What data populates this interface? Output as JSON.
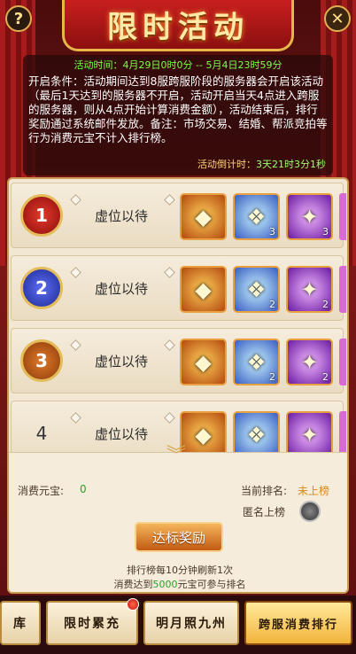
{
  "header": {
    "title": "限时活动",
    "help_icon": "help-icon",
    "close_icon": "close-icon"
  },
  "info": {
    "time_label": "活动时间：",
    "time_value": "4月29日0时0分 -- 5月4日23时59分",
    "description": "开启条件：活动期间达到8服跨服阶段的服务器会开启该活动（最后1天达到的服务器不开启，活动开启当天4点进入跨服的服务器，则从4点开始计算消费金额），活动结束后，排行奖励通过系统邮件发放。备注：市场交易、结婚、帮派竞拍等行为消费元宝不计入排行榜。",
    "countdown_label": "活动倒计时：",
    "countdown_value": "3天21时3分1秒"
  },
  "rankings": [
    {
      "rank": "1",
      "name": "虚位以待",
      "rewards": [
        {
          "icon": "gold-token-icon",
          "count": ""
        },
        {
          "icon": "blue-gem-icon",
          "count": "3"
        },
        {
          "icon": "purple-orb-icon",
          "count": "3"
        }
      ]
    },
    {
      "rank": "2",
      "name": "虚位以待",
      "rewards": [
        {
          "icon": "gold-token-icon",
          "count": ""
        },
        {
          "icon": "blue-gem-icon",
          "count": "2"
        },
        {
          "icon": "purple-orb-icon",
          "count": "2"
        }
      ]
    },
    {
      "rank": "3",
      "name": "虚位以待",
      "rewards": [
        {
          "icon": "gold-token-icon",
          "count": ""
        },
        {
          "icon": "blue-gem-icon",
          "count": "2"
        },
        {
          "icon": "purple-orb-icon",
          "count": "2"
        }
      ]
    },
    {
      "rank": "4",
      "name": "虚位以待",
      "rewards": [
        {
          "icon": "gold-token-icon",
          "count": ""
        },
        {
          "icon": "blue-gem-icon",
          "count": ""
        },
        {
          "icon": "purple-orb-icon",
          "count": ""
        }
      ]
    }
  ],
  "stats": {
    "spent_label": "消费元宝:",
    "spent_value": "0",
    "current_rank_label": "当前排名:",
    "current_rank_value": "未上榜",
    "anonymous_label": "匿名上榜"
  },
  "reward_button": "达标奖励",
  "notes": {
    "refresh": "排行榜每10分钟刷新1次",
    "min_prefix": "消费达到",
    "min_value": "5000",
    "min_suffix": "元宝可参与排名"
  },
  "tabs": [
    {
      "label": "库"
    },
    {
      "label": "限时累充"
    },
    {
      "label": "明月照九州"
    },
    {
      "label": "跨服消费排行"
    }
  ],
  "colors": {
    "accent": "#f2b43c",
    "green": "#2ba02b",
    "orange": "#d88a1a"
  }
}
